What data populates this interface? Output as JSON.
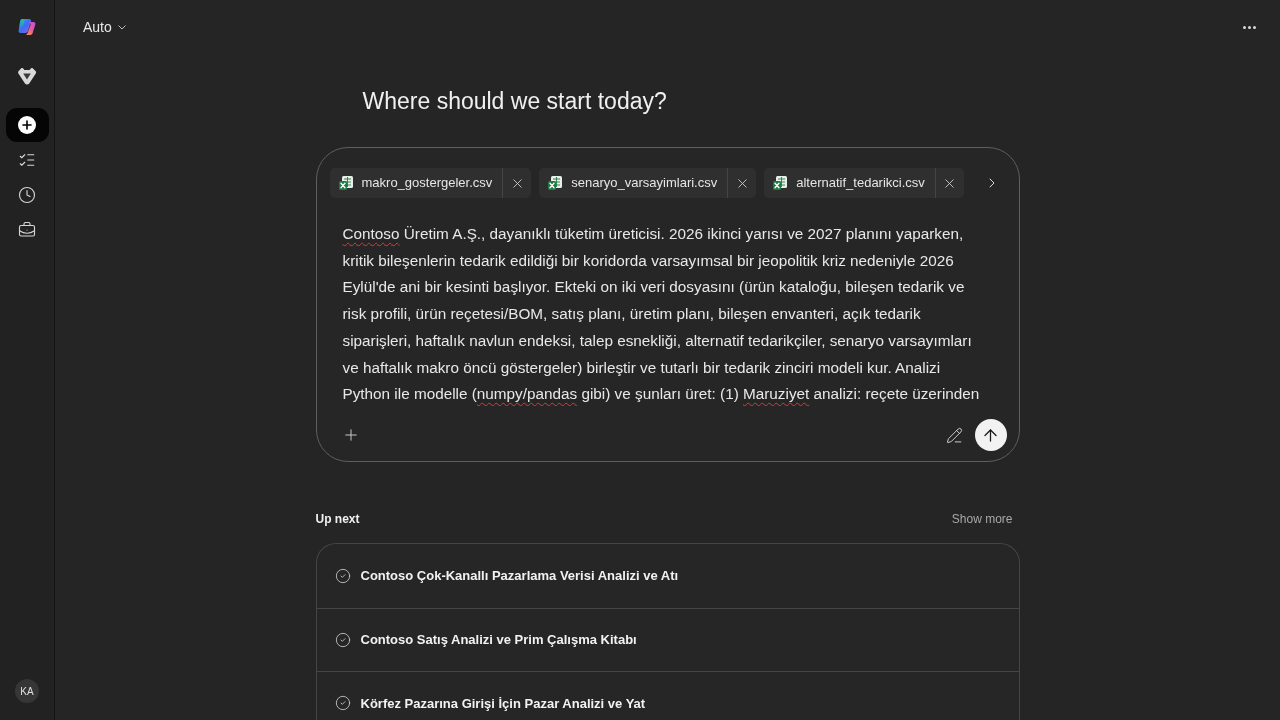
{
  "sidebar": {
    "items": [
      {
        "kind": "compose",
        "selected": true
      },
      {
        "kind": "tasks",
        "selected": false
      },
      {
        "kind": "history",
        "selected": false
      },
      {
        "kind": "toolbox",
        "selected": false
      }
    ],
    "avatar": "KA"
  },
  "top_bar": {
    "model_picker": "Auto"
  },
  "heading": "Where should we start today?",
  "composer": {
    "attachments": [
      {
        "name": "makro_gostergeler.csv"
      },
      {
        "name": "senaryo_varsayimlari.csv"
      },
      {
        "name": "alternatif_tedarikci.csv"
      }
    ],
    "message_lines": [
      {
        "segments": [
          {
            "text": "Contoso",
            "misspelled": true
          },
          {
            "text": " Üretim A.Ş., dayanıklı tüketim üreticisi. 2026 ikinci yarısı ve 2027 planını yaparken,",
            "misspelled": false
          }
        ]
      },
      {
        "segments": [
          {
            "text": "kritik bileşenlerin tedarik edildiği bir koridorda varsayımsal bir jeopolitik kriz nedeniyle 2026",
            "misspelled": false
          }
        ]
      },
      {
        "segments": [
          {
            "text": "Eylül'de ani bir kesinti başlıyor. Ekteki on iki veri dosyasını (ürün kataloğu, bileşen tedarik ve",
            "misspelled": false
          }
        ]
      },
      {
        "segments": [
          {
            "text": "risk profili, ürün reçetesi/BOM, satış planı, üretim planı, bileşen envanteri, açık tedarik",
            "misspelled": false
          }
        ]
      },
      {
        "segments": [
          {
            "text": "siparişleri, haftalık navlun endeksi, talep esnekliği, alternatif tedarikçiler, senaryo varsayımları",
            "misspelled": false
          }
        ]
      },
      {
        "segments": [
          {
            "text": "ve haftalık makro öncü göstergeler) birleştir ve tutarlı bir tedarik zinciri modeli kur. Analizi",
            "misspelled": false
          }
        ]
      },
      {
        "segments": [
          {
            "text": "Python ile modelle (",
            "misspelled": false
          },
          {
            "text": "numpy/pandas",
            "misspelled": true
          },
          {
            "text": " gibi) ve şunları üret: (1) ",
            "misspelled": false
          },
          {
            "text": "Maruziyet",
            "misspelled": true
          },
          {
            "text": " analizi: reçete üzerinden",
            "misspelled": false
          }
        ]
      }
    ]
  },
  "up_next": {
    "title": "Up next",
    "show_more": "Show more",
    "items": [
      {
        "title": "Contoso Çok-Kanallı Pazarlama Verisi Analizi ve Atı"
      },
      {
        "title": "Contoso Satış Analizi ve Prim Çalışma Kitabı"
      },
      {
        "title": "Körfez Pazarına Girişi İçin Pazar Analizi ve Yat"
      }
    ]
  }
}
